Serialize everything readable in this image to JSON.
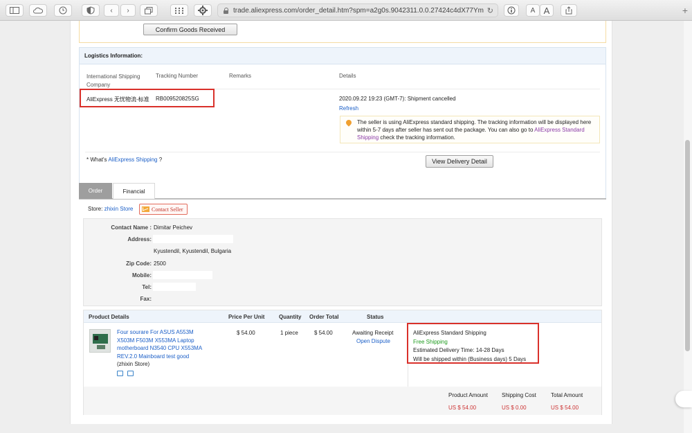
{
  "browser": {
    "url": "trade.aliexpress.com/order_detail.htm?spm=a2g0s.9042311.0.0.27424c4dX77Ym",
    "font_small": "A",
    "font_large": "A"
  },
  "confirm_button": "Confirm Goods Received",
  "logistics": {
    "title": "Logistics Information:",
    "headers": {
      "company": "International Shipping Company",
      "tracking": "Tracking Number",
      "remarks": "Remarks",
      "details": "Details"
    },
    "company": "AliExpress 无忧物流-标准",
    "tracking_number": "RB009520825SG",
    "event": "2020.09.22 19:23 (GMT-7): Shipment cancelled",
    "refresh": "Refresh",
    "notice_text": "The seller is using AliExpress standard shipping. The tracking information will be displayed here within 5-7 days after seller has sent out the package. You can also go to",
    "notice_link": "AliExpress Standard Shipping",
    "notice_tail": "check the tracking information.",
    "whats_prefix": "* What's",
    "whats_link": "AliExpress Shipping",
    "whats_suffix": "?",
    "view_button": "View Delivery Detail"
  },
  "tabs": [
    "Order",
    "Financial"
  ],
  "store": {
    "label": "Store:",
    "name": "zhixin Store",
    "contact_seller": "Contact Seller"
  },
  "address": {
    "contact_label": "Contact Name :",
    "contact_value": "Dimitar Peichev",
    "address_label": "Address:",
    "address_value": "Kyustendil, Kyustendil, Bulgaria",
    "zip_label": "Zip Code:",
    "zip_value": "2500",
    "mobile_label": "Mobile:",
    "tel_label": "Tel:",
    "fax_label": "Fax:"
  },
  "product": {
    "headers": {
      "details": "Product Details",
      "price": "Price Per Unit",
      "quantity": "Quantity",
      "total": "Order Total",
      "status": "Status"
    },
    "title_lines": [
      "Four sourare For ASUS A553M",
      "X503M F503M X553MA Laptop",
      "motherboard N3540 CPU X553MA",
      "REV.2.0 Mainboard test good"
    ],
    "store_note": "(zhixin Store)",
    "price": "$ 54.00",
    "quantity": "1 piece",
    "order_total": "$ 54.00",
    "status": "Awaiting Receipt",
    "open_dispute": "Open Dispute",
    "shipping": {
      "method": "AliExpress Standard Shipping",
      "free": "Free Shipping",
      "estimated": "Estimated Delivery Time: 14-28 Days",
      "ship_within": "Will be shipped within (Business days) 5 Days"
    }
  },
  "summary": {
    "product_amount_label": "Product Amount",
    "product_amount": "US $ 54.00",
    "shipping_cost_label": "Shipping Cost",
    "shipping_cost": "US $ 0.00",
    "total_amount_label": "Total Amount",
    "total_amount": "US $ 54.00"
  },
  "colors": {
    "link": "#1a5ec7",
    "highlight_box": "#d9302a",
    "free_shipping": "#1e9b1e",
    "price": "#cc3333"
  }
}
